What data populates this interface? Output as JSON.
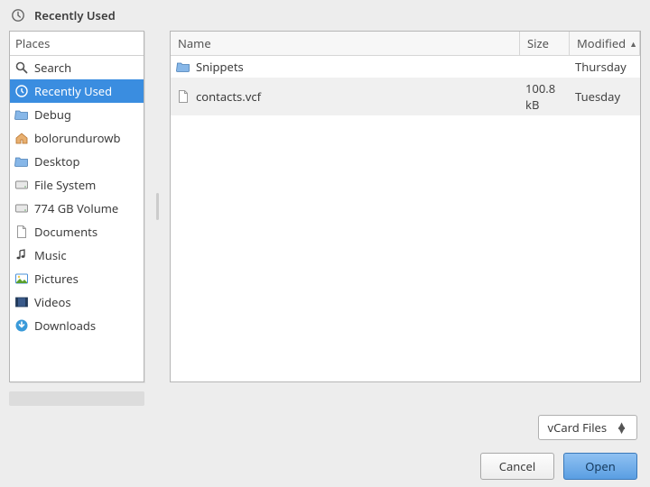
{
  "header": {
    "title": "Recently Used"
  },
  "sidebar": {
    "header": "Places",
    "items": [
      {
        "label": "Search",
        "icon": "search"
      },
      {
        "label": "Recently Used",
        "icon": "clock-inv",
        "selected": true
      },
      {
        "label": "Debug",
        "icon": "folder"
      },
      {
        "label": "bolorundurowb",
        "icon": "home"
      },
      {
        "label": "Desktop",
        "icon": "folder"
      },
      {
        "label": "File System",
        "icon": "drive"
      },
      {
        "label": "774 GB Volume",
        "icon": "drive"
      },
      {
        "label": "Documents",
        "icon": "doc"
      },
      {
        "label": "Music",
        "icon": "music"
      },
      {
        "label": "Pictures",
        "icon": "pictures"
      },
      {
        "label": "Videos",
        "icon": "video"
      },
      {
        "label": "Downloads",
        "icon": "download"
      }
    ]
  },
  "columns": {
    "name": "Name",
    "size": "Size",
    "modified": "Modified",
    "sort": "▲"
  },
  "files": [
    {
      "name": "Snippets",
      "icon": "folder",
      "size": "",
      "modified": "Thursday",
      "selected": false
    },
    {
      "name": "contacts.vcf",
      "icon": "doc",
      "size": "100.8 kB",
      "modified": "Tuesday",
      "selected": true
    }
  ],
  "filter": {
    "label": "vCard Files"
  },
  "buttons": {
    "cancel": "Cancel",
    "open": "Open"
  }
}
